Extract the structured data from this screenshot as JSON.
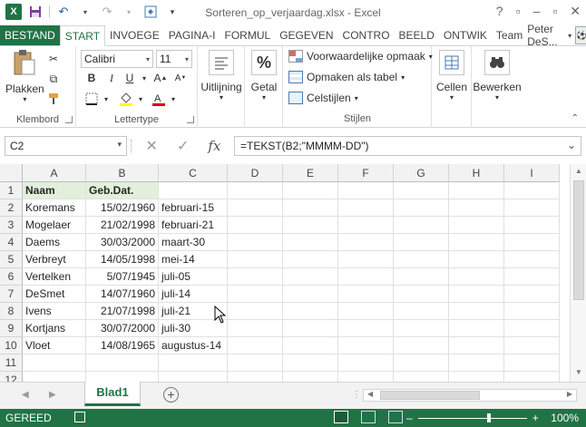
{
  "window": {
    "title": "Sorteren_op_verjaardag.xlsx - Excel",
    "controls": [
      "?",
      "▢",
      "–",
      "▢",
      "✕"
    ]
  },
  "tabs": [
    {
      "label": "BESTAND"
    },
    {
      "label": "START"
    },
    {
      "label": "INVOEGE"
    },
    {
      "label": "PAGINA-I"
    },
    {
      "label": "FORMUL"
    },
    {
      "label": "GEGEVEN"
    },
    {
      "label": "CONTRO"
    },
    {
      "label": "BEELD"
    },
    {
      "label": "ONTWIK"
    },
    {
      "label": "Team"
    }
  ],
  "user": {
    "name": "Peter DeS..."
  },
  "ribbon": {
    "clipboard": {
      "label": "Klembord",
      "paste": "Plakken"
    },
    "font": {
      "label": "Lettertype",
      "name": "Calibri",
      "size": "11",
      "bold": "B",
      "italic": "I",
      "underline": "U"
    },
    "alignment": {
      "label": "Uitlijning"
    },
    "number": {
      "label": "Getal",
      "symbol": "%"
    },
    "styles": {
      "label": "Stijlen",
      "conditional": "Voorwaardelijke opmaak",
      "format_table": "Opmaken als tabel",
      "cell_styles": "Celstijlen"
    },
    "cells": {
      "label": "Cellen"
    },
    "editing": {
      "label": "Bewerken"
    }
  },
  "formula_bar": {
    "name_box": "C2",
    "formula": "=TEKST(B2;\"MMMM-DD\")",
    "fx": "fx"
  },
  "sheet": {
    "columns": [
      "A",
      "B",
      "C",
      "D",
      "E",
      "F",
      "G",
      "H",
      "I"
    ],
    "rows": [
      "1",
      "2",
      "3",
      "4",
      "5",
      "6",
      "7",
      "8",
      "9",
      "10",
      "11",
      "12"
    ],
    "header": [
      "Naam",
      "Geb.Dat."
    ],
    "data": [
      [
        "Koremans",
        "15/02/1960",
        "februari-15"
      ],
      [
        "Mogelaer",
        "21/02/1998",
        "februari-21"
      ],
      [
        "Daems",
        "30/03/2000",
        "maart-30"
      ],
      [
        "Verbreyt",
        "14/05/1998",
        "mei-14"
      ],
      [
        "Vertelken",
        "5/07/1945",
        "juli-05"
      ],
      [
        "DeSmet",
        "14/07/1960",
        "juli-14"
      ],
      [
        "Ivens",
        "21/07/1998",
        "juli-21"
      ],
      [
        "Kortjans",
        "30/07/2000",
        "juli-30"
      ],
      [
        "Vloet",
        "14/08/1965",
        "augustus-14"
      ]
    ]
  },
  "sheet_tabs": {
    "active": "Blad1"
  },
  "status": {
    "ready": "GEREED",
    "zoom": "100%"
  }
}
